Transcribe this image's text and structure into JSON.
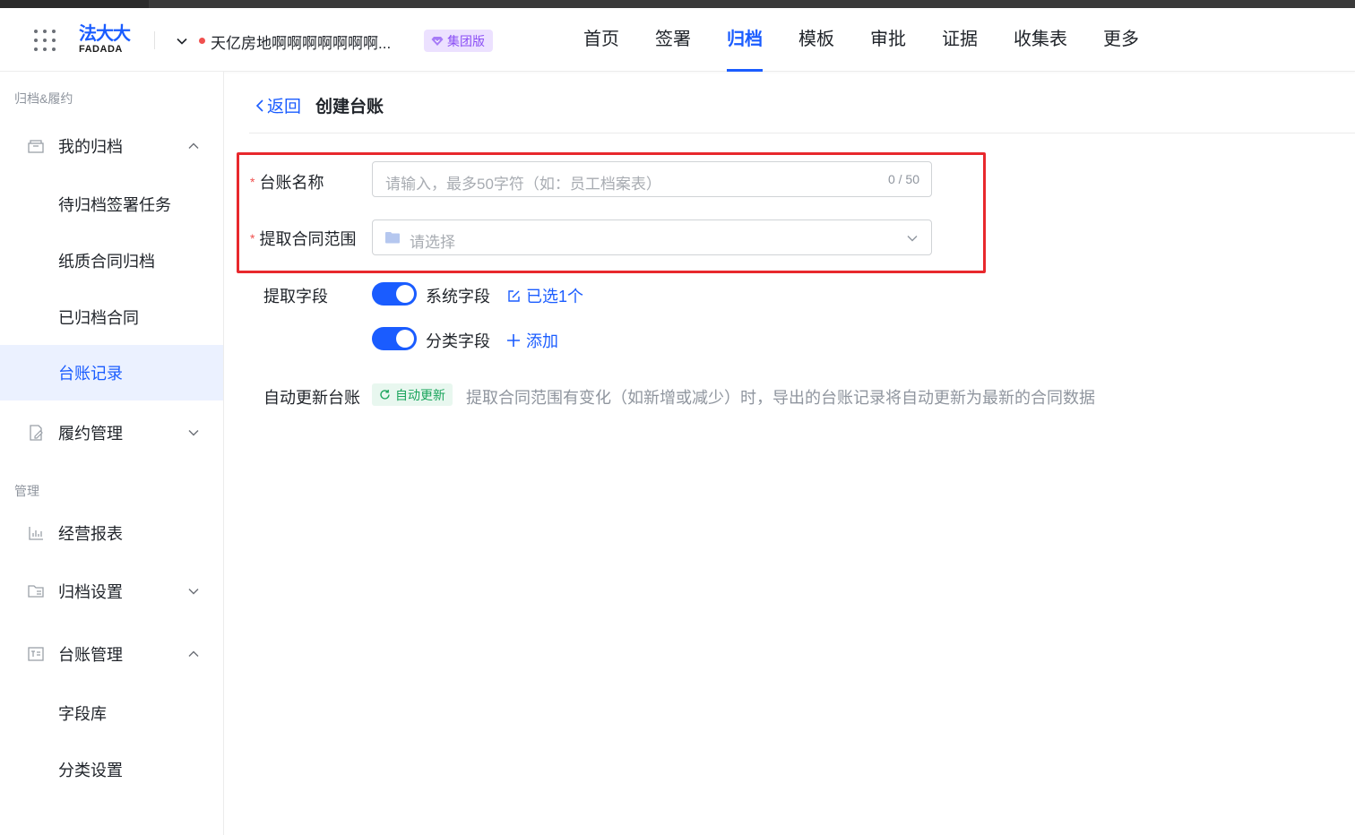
{
  "header": {
    "logo_cn": "法大大",
    "logo_en": "FADADA",
    "company_name": "天亿房地啊啊啊啊啊啊啊...",
    "edition_badge": "集团版",
    "nav": [
      {
        "label": "首页",
        "active": false
      },
      {
        "label": "签署",
        "active": false
      },
      {
        "label": "归档",
        "active": true
      },
      {
        "label": "模板",
        "active": false
      },
      {
        "label": "审批",
        "active": false
      },
      {
        "label": "证据",
        "active": false
      },
      {
        "label": "收集表",
        "active": false
      },
      {
        "label": "更多",
        "active": false
      }
    ]
  },
  "sidebar": {
    "section_archive": "归档&履约",
    "my_archive": "我的归档",
    "pending_tasks": "待归档签署任务",
    "paper_archive": "纸质合同归档",
    "archived_contracts": "已归档合同",
    "ledger_records": "台账记录",
    "performance": "履约管理",
    "section_manage": "管理",
    "reports": "经营报表",
    "archive_settings": "归档设置",
    "ledger_manage": "台账管理",
    "field_library": "字段库",
    "category_settings": "分类设置"
  },
  "content": {
    "back_label": "返回",
    "page_title": "创建台账",
    "ledger_name_label": "台账名称",
    "ledger_name_placeholder": "请输入，最多50字符（如：员工档案表）",
    "ledger_name_count": "0 / 50",
    "scope_label": "提取合同范围",
    "scope_placeholder": "请选择",
    "fields_label": "提取字段",
    "system_fields_label": "系统字段",
    "system_fields_link": "已选1个",
    "category_fields_label": "分类字段",
    "category_fields_link": "添加",
    "auto_update_label": "自动更新台账",
    "auto_update_tag": "自动更新",
    "auto_update_desc": "提取合同范围有变化（如新增或减少）时，导出的台账记录将自动更新为最新的合同数据"
  },
  "colors": {
    "primary": "#1a5cff",
    "required": "#f0504e",
    "highlight_box": "#e8282d",
    "badge_purple": "#8b4ff5",
    "tag_green": "#19a45b"
  }
}
